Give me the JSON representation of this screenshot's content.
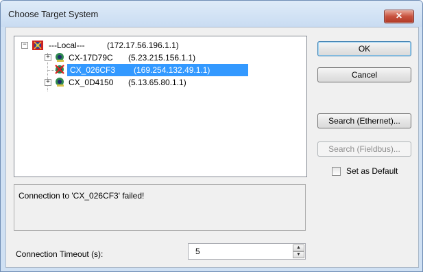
{
  "window": {
    "title": "Choose Target System",
    "close_label": "✕"
  },
  "tree": {
    "root": {
      "label": "---Local---",
      "address": "(172.17.56.196.1.1)",
      "expander": "−"
    },
    "children": [
      {
        "label": "CX-17D79C",
        "address": "(5.23.215.156.1.1)",
        "expander": "+",
        "selected": false,
        "failed": false
      },
      {
        "label": "CX_026CF3",
        "address": "(169.254.132.49.1.1)",
        "expander": "",
        "selected": true,
        "failed": true
      },
      {
        "label": "CX_0D4150",
        "address": "(5.13.65.80.1.1)",
        "expander": "+",
        "selected": false,
        "failed": false
      }
    ]
  },
  "buttons": {
    "ok": "OK",
    "cancel": "Cancel",
    "search_ethernet": "Search (Ethernet)...",
    "search_fieldbus": "Search (Fieldbus)..."
  },
  "set_as_default": {
    "label": "Set as Default",
    "checked": false
  },
  "status": {
    "message": "Connection to 'CX_026CF3' failed!"
  },
  "timeout": {
    "label": "Connection Timeout (s):",
    "value": "5"
  },
  "colors": {
    "selection": "#3399ff",
    "close_button": "#c7513d",
    "failure_mark": "#e02020"
  }
}
